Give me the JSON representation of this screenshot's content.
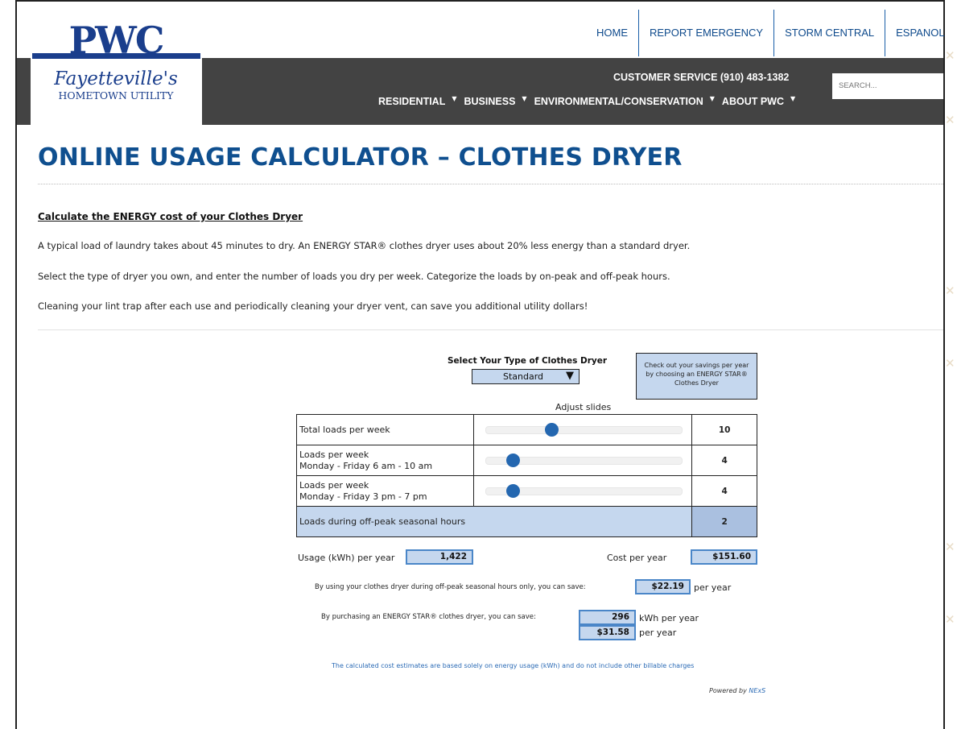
{
  "header": {
    "topnav": [
      "HOME",
      "REPORT EMERGENCY",
      "STORM CENTRAL",
      "ESPANOL"
    ],
    "customer_service": "CUSTOMER SERVICE (910) 483-1382",
    "mainnav": [
      "RESIDENTIAL",
      "BUSINESS",
      "ENVIRONMENTAL/CONSERVATION",
      "ABOUT PWC"
    ],
    "search_placeholder": "SEARCH..."
  },
  "logo": {
    "mark": "PWC",
    "line1": "Fayetteville's",
    "line2": "HOMETOWN UTILITY",
    "color": "#1a3e8c"
  },
  "page": {
    "title": "ONLINE USAGE CALCULATOR – CLOTHES DRYER",
    "heading": "Calculate the ENERGY cost of your Clothes Dryer",
    "paragraphs": [
      "A typical load of laundry takes about 45 minutes to dry. An ENERGY STAR® clothes dryer uses about 20% less energy than a standard dryer.",
      "Select the type of dryer you own, and enter the number of loads you dry per week. Categorize the loads by on-peak and off-peak hours.",
      "Cleaning your lint trap after each use and periodically cleaning your dryer vent, can save you additional utility dollars!"
    ]
  },
  "calculator": {
    "select_label": "Select Your Type of Clothes Dryer",
    "dryer_type": "Standard",
    "energy_star_note": "Check out your savings per year by choosing an ENERGY STAR® Clothes Dryer",
    "adjust_label": "Adjust slides",
    "rows": [
      {
        "label_line1": "Total loads per week",
        "label_line2": "",
        "value": "10",
        "slider_fraction": 0.34
      },
      {
        "label_line1": "Loads per week",
        "label_line2": "Monday - Friday 6 am - 10 am",
        "value": "4",
        "slider_fraction": 0.14
      },
      {
        "label_line1": "Loads per week",
        "label_line2": "Monday - Friday 3 pm - 7 pm",
        "value": "4",
        "slider_fraction": 0.14
      }
    ],
    "offpeak_label": "Loads during off-peak seasonal hours",
    "offpeak_value": "2",
    "usage_label": "Usage (kWh) per year",
    "usage_value": "1,422",
    "cost_label": "Cost per year",
    "cost_value": "$151.60",
    "offpeak_savings_text": "By using your clothes dryer during off-peak seasonal hours only, you can save:",
    "offpeak_savings_value": "$22.19",
    "per_year": "per year",
    "energy_star_savings_text": "By purchasing an ENERGY STAR® clothes dryer, you can save:",
    "energy_star_kwh": "296",
    "kwh_per_year": "kWh per year",
    "energy_star_dollars": "$31.58",
    "footnote": "The calculated cost estimates are based solely on energy usage (kWh) and do not include other billable charges",
    "powered_by": "Powered by",
    "powered_brand": "NExS"
  },
  "colors": {
    "title": "#0f4f8f",
    "header_bar": "#434343",
    "accent_blue": "#2467b0",
    "box_fill": "#c5d7ee"
  }
}
